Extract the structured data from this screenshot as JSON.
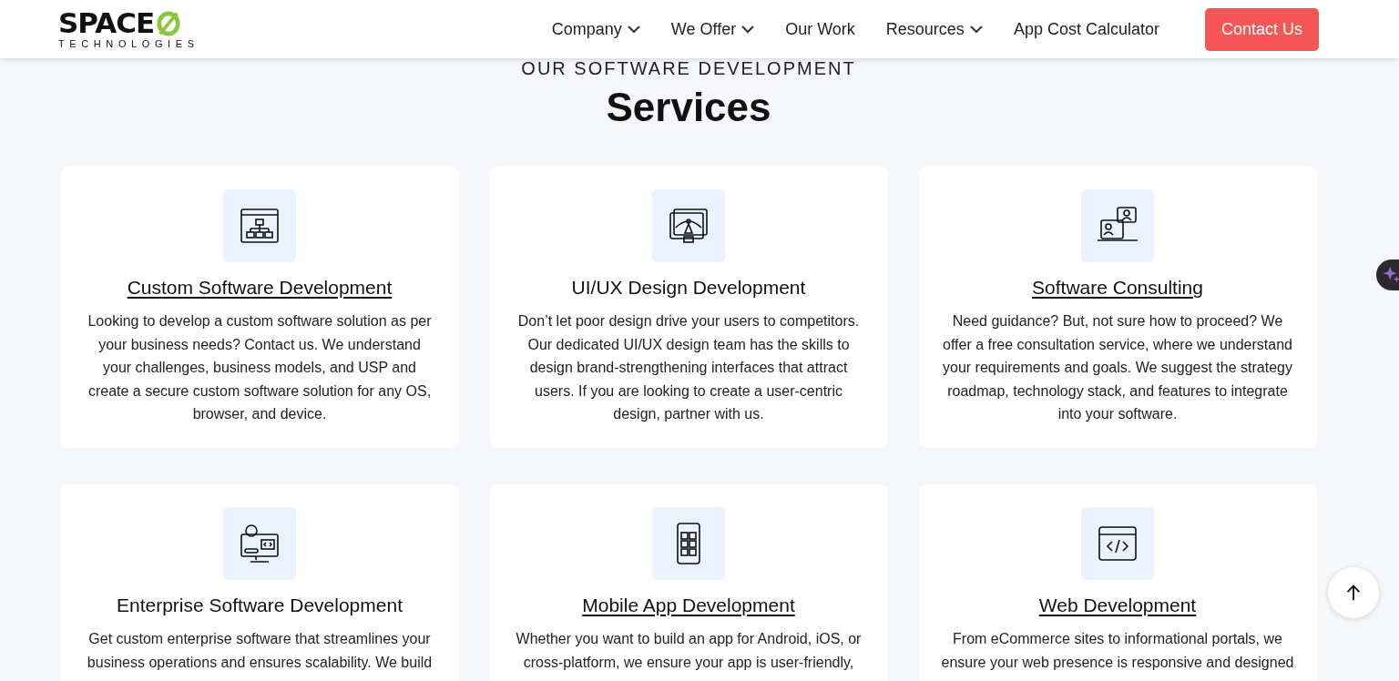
{
  "header": {
    "logo": {
      "word": "SPACE",
      "sub": "TECHNOLOGIES"
    },
    "nav": [
      {
        "label": "Company",
        "dropdown": true
      },
      {
        "label": "We Offer",
        "dropdown": true
      },
      {
        "label": "Our Work",
        "dropdown": false
      },
      {
        "label": "Resources",
        "dropdown": true
      },
      {
        "label": "App Cost Calculator",
        "dropdown": false
      }
    ],
    "cta": "Contact Us"
  },
  "section": {
    "eyebrow": "OUR SOFTWARE DEVELOPMENT",
    "title": "Services"
  },
  "services": [
    {
      "title": "Custom Software Development",
      "linked": true,
      "text": "Looking to develop a custom software solution as per your business needs? Contact us. We understand your challenges, business models, and USP and create a secure custom software solution for any OS, browser, and device."
    },
    {
      "title": "UI/UX Design Development",
      "linked": false,
      "text": "Don’t let poor design drive your users to competitors. Our dedicated UI/UX design team has the skills to design brand-strengthening interfaces that attract users. If you are looking to create a user-centric design, partner with us."
    },
    {
      "title": "Software Consulting",
      "linked": true,
      "text": "Need guidance? But, not sure how to proceed? We offer a free consultation service, where we understand your requirements and goals. We suggest the strategy roadmap, technology stack, and features to integrate into your software."
    },
    {
      "title": "Enterprise Software Development",
      "linked": false,
      "text": "Get custom enterprise software that streamlines your business operations and ensures scalability. We build"
    },
    {
      "title": "Mobile App Development",
      "linked": true,
      "text": "Whether you want to build an app for Android, iOS, or cross-platform, we ensure your app is user-friendly,"
    },
    {
      "title": "Web Development",
      "linked": true,
      "text": "From eCommerce sites to informational portals, we ensure your web presence is responsive and designed"
    }
  ]
}
